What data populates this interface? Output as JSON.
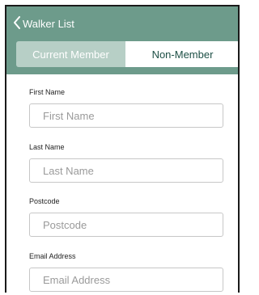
{
  "colors": {
    "header_bg": "#6d9b8b",
    "segment_active_text": "#1d4f45",
    "segment_inactive_bg": "#b7cfc6"
  },
  "nav": {
    "back_icon": "chevron-left-icon",
    "back_label": "Walker List"
  },
  "segment": {
    "options": [
      "Current Member",
      "Non-Member"
    ],
    "selected": "Non-Member"
  },
  "form": {
    "fields": [
      {
        "label": "First Name",
        "placeholder": "First Name",
        "value": ""
      },
      {
        "label": "Last Name",
        "placeholder": "Last Name",
        "value": ""
      },
      {
        "label": "Postcode",
        "placeholder": "Postcode",
        "value": ""
      },
      {
        "label": "Email Address",
        "placeholder": "Email Address",
        "value": ""
      }
    ]
  }
}
